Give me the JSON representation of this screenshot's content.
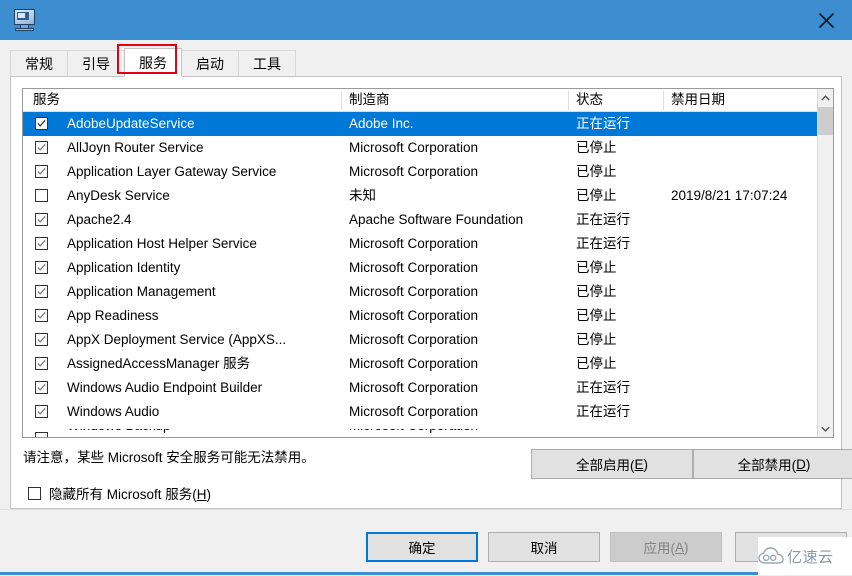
{
  "window": {
    "title": "",
    "icon": "system-configuration-icon",
    "close_label": "✕",
    "titlebar_color": "#3c8ed0"
  },
  "tabs": [
    {
      "label": "常规",
      "active": false
    },
    {
      "label": "引导",
      "active": false
    },
    {
      "label": "服务",
      "active": true
    },
    {
      "label": "启动",
      "active": false
    },
    {
      "label": "工具",
      "active": false
    }
  ],
  "highlight": {
    "color": "#e60012",
    "target_tab": "服务"
  },
  "table": {
    "columns": [
      "服务",
      "制造商",
      "状态",
      "禁用日期"
    ],
    "rows": [
      {
        "checked": true,
        "name": "AdobeUpdateService",
        "vendor": "Adobe Inc.",
        "status": "正在运行",
        "date": "",
        "selected": true
      },
      {
        "checked": true,
        "name": "AllJoyn Router Service",
        "vendor": "Microsoft Corporation",
        "status": "已停止",
        "date": "",
        "selected": false
      },
      {
        "checked": true,
        "name": "Application Layer Gateway Service",
        "vendor": "Microsoft Corporation",
        "status": "已停止",
        "date": "",
        "selected": false
      },
      {
        "checked": false,
        "name": "AnyDesk Service",
        "vendor": "未知",
        "status": "已停止",
        "date": "2019/8/21 17:07:24",
        "selected": false
      },
      {
        "checked": true,
        "name": "Apache2.4",
        "vendor": "Apache Software Foundation",
        "status": "正在运行",
        "date": "",
        "selected": false
      },
      {
        "checked": true,
        "name": "Application Host Helper Service",
        "vendor": "Microsoft Corporation",
        "status": "正在运行",
        "date": "",
        "selected": false
      },
      {
        "checked": true,
        "name": "Application Identity",
        "vendor": "Microsoft Corporation",
        "status": "已停止",
        "date": "",
        "selected": false
      },
      {
        "checked": true,
        "name": "Application Management",
        "vendor": "Microsoft Corporation",
        "status": "已停止",
        "date": "",
        "selected": false
      },
      {
        "checked": true,
        "name": "App Readiness",
        "vendor": "Microsoft Corporation",
        "status": "已停止",
        "date": "",
        "selected": false
      },
      {
        "checked": true,
        "name": "AppX Deployment Service (AppXS...",
        "vendor": "Microsoft Corporation",
        "status": "已停止",
        "date": "",
        "selected": false
      },
      {
        "checked": true,
        "name": "AssignedAccessManager 服务",
        "vendor": "Microsoft Corporation",
        "status": "已停止",
        "date": "",
        "selected": false
      },
      {
        "checked": true,
        "name": "Windows Audio Endpoint Builder",
        "vendor": "Microsoft Corporation",
        "status": "正在运行",
        "date": "",
        "selected": false
      },
      {
        "checked": true,
        "name": "Windows Audio",
        "vendor": "Microsoft Corporation",
        "status": "正在运行",
        "date": "",
        "selected": false
      }
    ],
    "partial_row": {
      "checked": false,
      "name": "Windows Backup",
      "vendor": "Microsoft Corporation",
      "status": "",
      "date": ""
    }
  },
  "note": "请注意，某些 Microsoft 安全服务可能无法禁用。",
  "hide_microsoft": {
    "label_prefix": "隐藏所有 Microsoft 服务(",
    "accel": "H",
    "label_suffix": ")",
    "checked": false
  },
  "actions": {
    "enable_all_prefix": "全部启用(",
    "enable_all_accel": "E",
    "enable_all_suffix": ")",
    "disable_all_prefix": "全部禁用(",
    "disable_all_accel": "D",
    "disable_all_suffix": ")"
  },
  "footer": {
    "ok": "确定",
    "cancel": "取消",
    "apply_prefix": "应用(",
    "apply_accel": "A",
    "apply_suffix": ")",
    "help": ""
  },
  "watermark": {
    "text": "亿速云",
    "color": "#8b98a6"
  },
  "colors": {
    "selection": "#0078d7",
    "titlebar": "#3c8ed0",
    "highlight_box": "#e60012",
    "window_bg": "#f0f0f0"
  }
}
